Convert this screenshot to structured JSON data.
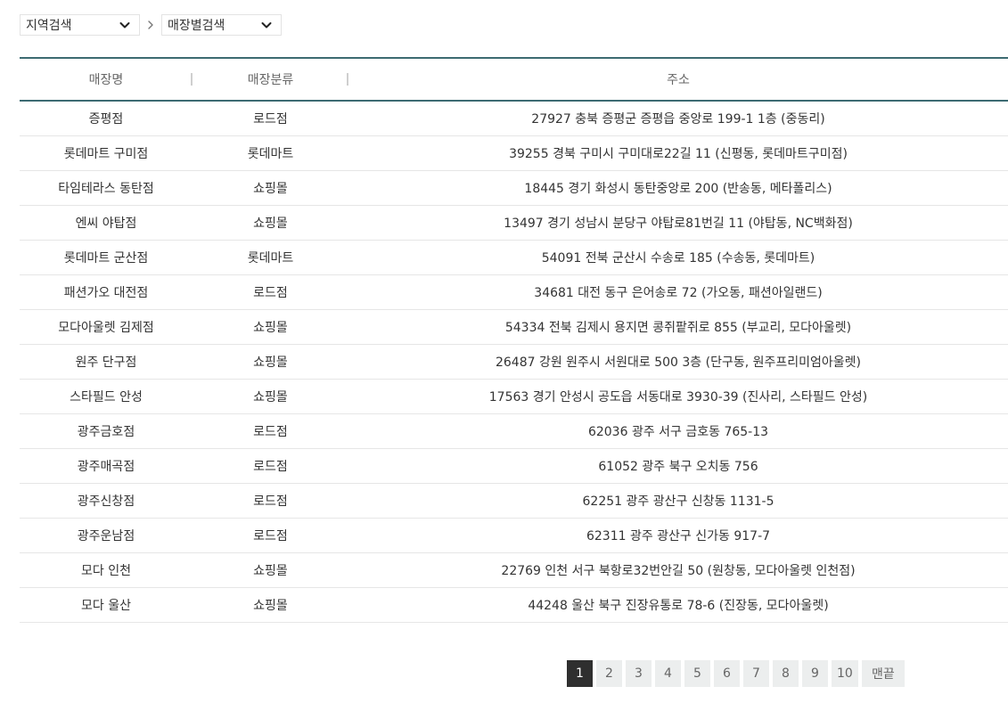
{
  "filters": {
    "region": {
      "value": "지역검색"
    },
    "store": {
      "value": "매장별검색"
    },
    "separator": "›"
  },
  "table": {
    "headers": {
      "name": "매장명",
      "type": "매장분류",
      "address": "주소"
    },
    "rows": [
      {
        "name": "증평점",
        "type": "로드점",
        "address": "27927 충북 증평군 증평읍 중앙로 199-1 1층 (중동리)"
      },
      {
        "name": "롯데마트 구미점",
        "type": "롯데마트",
        "address": "39255 경북 구미시 구미대로22길 11 (신평동, 롯데마트구미점)"
      },
      {
        "name": "타임테라스 동탄점",
        "type": "쇼핑몰",
        "address": "18445 경기 화성시 동탄중앙로 200 (반송동, 메타폴리스)"
      },
      {
        "name": "엔씨 야탑점",
        "type": "쇼핑몰",
        "address": "13497 경기 성남시 분당구 야탑로81번길 11 (야탑동, NC백화점)"
      },
      {
        "name": "롯데마트 군산점",
        "type": "롯데마트",
        "address": "54091 전북 군산시 수송로 185 (수송동, 롯데마트)"
      },
      {
        "name": "패션가오 대전점",
        "type": "로드점",
        "address": "34681 대전 동구 은어송로 72 (가오동, 패션아일랜드)"
      },
      {
        "name": "모다아울렛 김제점",
        "type": "쇼핑몰",
        "address": "54334 전북 김제시 용지면 콩쥐팥쥐로 855 (부교리, 모다아울렛)"
      },
      {
        "name": "원주 단구점",
        "type": "쇼핑몰",
        "address": "26487 강원 원주시 서원대로 500 3층 (단구동, 원주프리미엄아울렛)"
      },
      {
        "name": "스타필드 안성",
        "type": "쇼핑몰",
        "address": "17563 경기 안성시 공도읍 서동대로 3930-39 (진사리, 스타필드 안성)"
      },
      {
        "name": "광주금호점",
        "type": "로드점",
        "address": "62036 광주 서구 금호동 765-13"
      },
      {
        "name": "광주매곡점",
        "type": "로드점",
        "address": "61052 광주 북구 오치동 756"
      },
      {
        "name": "광주신창점",
        "type": "로드점",
        "address": "62251 광주 광산구 신창동 1131-5"
      },
      {
        "name": "광주운남점",
        "type": "로드점",
        "address": "62311 광주 광산구 신가동 917-7"
      },
      {
        "name": "모다 인천",
        "type": "쇼핑몰",
        "address": "22769 인천 서구 북항로32번안길 50 (원창동, 모다아울렛 인천점)"
      },
      {
        "name": "모다 울산",
        "type": "쇼핑몰",
        "address": "44248 울산 북구 진장유통로 78-6 (진장동, 모다아울렛)"
      }
    ]
  },
  "pagination": {
    "pages": [
      "1",
      "2",
      "3",
      "4",
      "5",
      "6",
      "7",
      "8",
      "9",
      "10"
    ],
    "current": "1",
    "last_label": "맨끝"
  },
  "colors": {
    "header_border": "#3d6b72",
    "active_page_bg": "#2f2f2f",
    "page_bg": "#eceeee"
  },
  "icons": {
    "dropdown": "chevron-down-icon",
    "breadcrumb": "chevron-right-icon"
  }
}
